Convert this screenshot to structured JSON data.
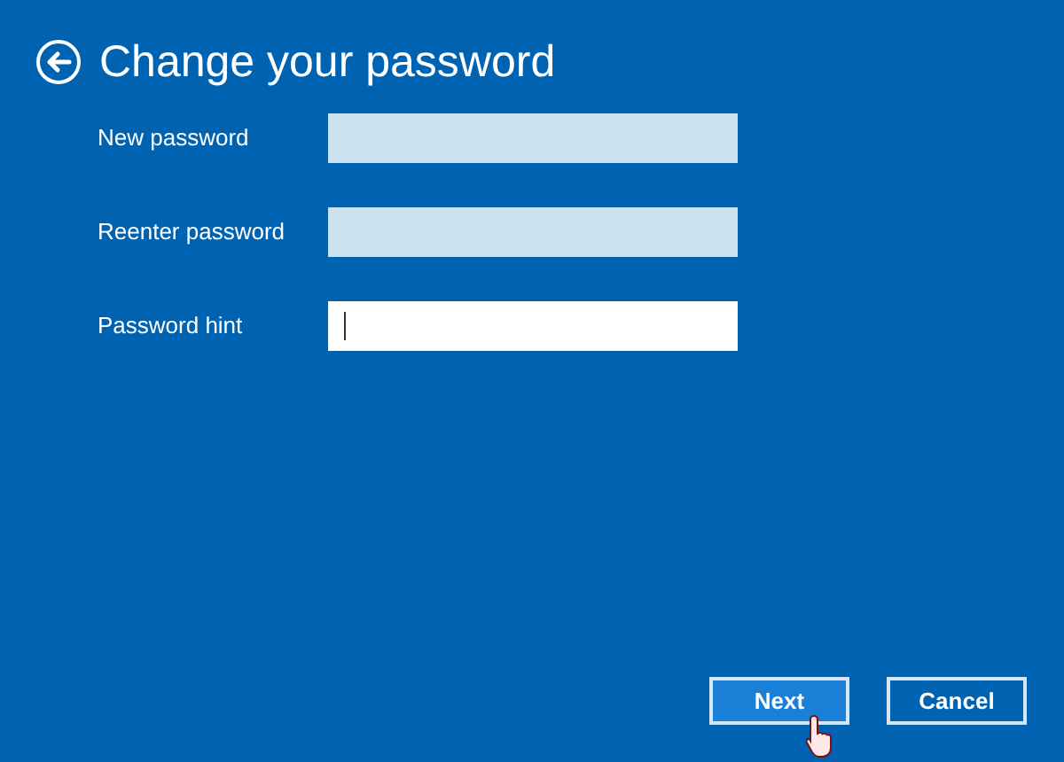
{
  "title": "Change your password",
  "fields": [
    {
      "label": "New password",
      "focused": false
    },
    {
      "label": "Reenter password",
      "focused": false
    },
    {
      "label": "Password hint",
      "focused": true
    }
  ],
  "buttons": [
    {
      "label": "Next",
      "hovered": true
    },
    {
      "label": "Cancel",
      "hovered": false
    }
  ]
}
